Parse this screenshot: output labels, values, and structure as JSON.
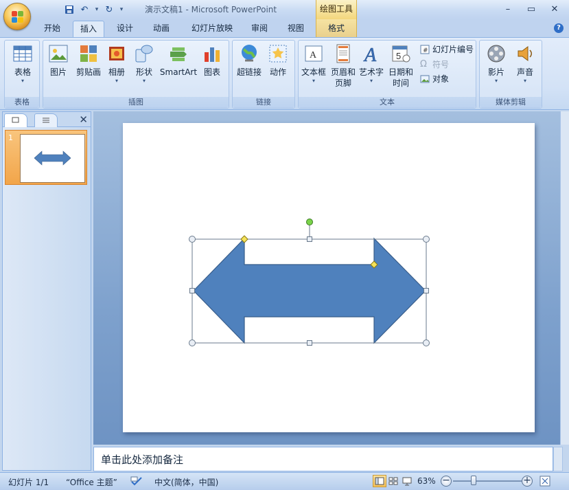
{
  "window": {
    "title": "演示文稿1 - Microsoft PowerPoint",
    "context_tools": "绘图工具",
    "controls": [
      "minimize",
      "maximize",
      "close"
    ]
  },
  "tabs": [
    {
      "label": "开始",
      "active": false
    },
    {
      "label": "插入",
      "active": true
    },
    {
      "label": "设计",
      "active": false
    },
    {
      "label": "动画",
      "active": false
    },
    {
      "label": "幻灯片放映",
      "active": false
    },
    {
      "label": "审阅",
      "active": false
    },
    {
      "label": "视图",
      "active": false
    },
    {
      "label": "格式",
      "active": false,
      "context": true
    }
  ],
  "ribbon": {
    "groups": {
      "table": "表格",
      "illustrations": "插图",
      "links": "链接",
      "text": "文本",
      "media": "媒体剪辑"
    },
    "buttons": {
      "table": "表格",
      "picture": "图片",
      "clipart": "剪贴画",
      "album": "相册",
      "shapes": "形状",
      "smartart": "SmartArt",
      "chart": "图表",
      "hyperlink": "超链接",
      "action": "动作",
      "textbox": "文本框",
      "header_footer_1": "页眉和",
      "header_footer_2": "页脚",
      "wordart": "艺术字",
      "datetime_1": "日期和",
      "datetime_2": "时间",
      "slide_number": "幻灯片编号",
      "symbol": "符号",
      "object": "对象",
      "movie": "影片",
      "sound": "声音"
    }
  },
  "slides_panel": {
    "slide_number": "1"
  },
  "notes": {
    "placeholder": "单击此处添加备注"
  },
  "status": {
    "slide_info": "幻灯片 1/1",
    "theme": "“Office 主题”",
    "language": "中文(简体，中国)",
    "zoom": "63%"
  },
  "colors": {
    "shape_fill": "#4f81bd",
    "shape_stroke": "#385d8a",
    "accent": "#f4a94d"
  }
}
